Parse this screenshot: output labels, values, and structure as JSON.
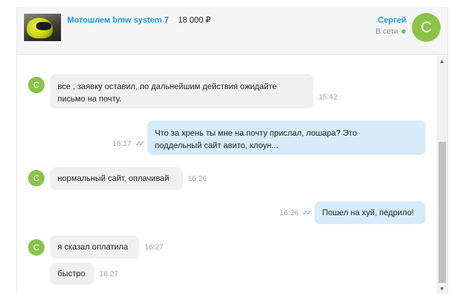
{
  "product": {
    "title": "Мотошлем bmw system 7",
    "price": "18 000 ₽"
  },
  "user": {
    "name": "Сергей",
    "status": "В сети",
    "avatar_letter": "С"
  },
  "messages": [
    {
      "direction": "in",
      "lines": [
        "все , заявку оставил, по дальнейшим действия ожидайте",
        "письмо на почту."
      ],
      "time": "15:42"
    },
    {
      "direction": "out",
      "lines": [
        "Что за хрень ты мне на почту прислал, лошара?  Это",
        "поддельный сайт авито, клоун..."
      ],
      "time": "16:17"
    },
    {
      "direction": "in",
      "lines": [
        "нормальный сайт, оплачивай"
      ],
      "time": "16:26"
    },
    {
      "direction": "out",
      "lines": [
        "Пошел на хуй, педрило!"
      ],
      "time": "16:26"
    },
    {
      "direction": "in",
      "lines": [
        "я сказал оплатила"
      ],
      "time": "16:27"
    },
    {
      "direction": "in",
      "lines": [
        "быстро"
      ],
      "time": "16:27"
    }
  ],
  "icons": {
    "read_check": "✓✓",
    "scroll_up": "▲",
    "scroll_down": "▼"
  },
  "colors": {
    "accent": "#1a9bdb",
    "avatar": "#8bc34a",
    "online": "#61c24b",
    "incoming_bubble": "#f0f0f0",
    "outgoing_bubble": "#d6ecfa"
  }
}
